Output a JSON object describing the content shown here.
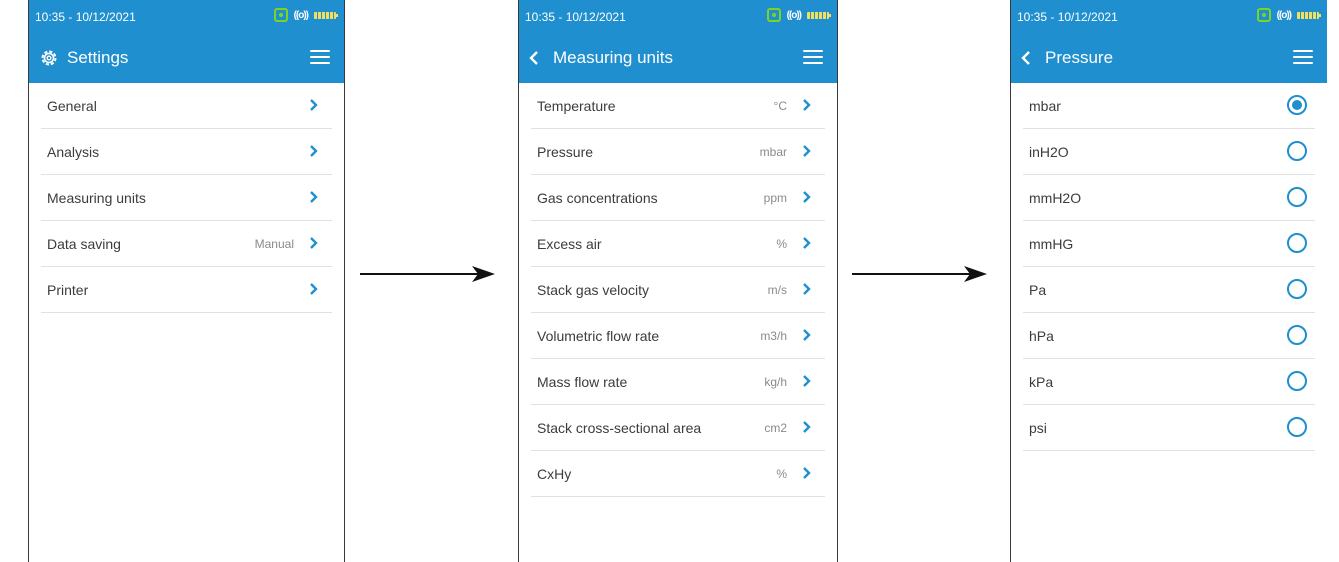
{
  "status": {
    "time": "10:35 - 10/12/2021"
  },
  "screen1": {
    "title": "Settings",
    "items": [
      {
        "label": "General",
        "value": ""
      },
      {
        "label": "Analysis",
        "value": ""
      },
      {
        "label": "Measuring units",
        "value": ""
      },
      {
        "label": "Data saving",
        "value": "Manual"
      },
      {
        "label": "Printer",
        "value": ""
      }
    ]
  },
  "screen2": {
    "title": "Measuring units",
    "items": [
      {
        "label": "Temperature",
        "value": "°C"
      },
      {
        "label": "Pressure",
        "value": "mbar"
      },
      {
        "label": "Gas concentrations",
        "value": "ppm"
      },
      {
        "label": "Excess air",
        "value": "%"
      },
      {
        "label": "Stack gas velocity",
        "value": "m/s"
      },
      {
        "label": "Volumetric flow rate",
        "value": "m3/h"
      },
      {
        "label": "Mass flow rate",
        "value": "kg/h"
      },
      {
        "label": "Stack cross-sectional area",
        "value": "cm2"
      },
      {
        "label": "CxHy",
        "value": "%"
      }
    ]
  },
  "screen3": {
    "title": "Pressure",
    "selected": "mbar",
    "options": [
      "mbar",
      "inH2O",
      "mmH2O",
      "mmHG",
      "Pa",
      "hPa",
      "kPa",
      "psi"
    ]
  },
  "colors": {
    "accent": "#1f8fcf",
    "divider": "#e1e1e1",
    "text": "#3c3c3c",
    "muted": "#8a8a8a"
  },
  "icons": {
    "settings": "gear-icon",
    "back": "chevron-left-icon",
    "menu": "hamburger-menu-icon",
    "next": "chevron-right-icon",
    "flow": "arrow-right-icon"
  }
}
